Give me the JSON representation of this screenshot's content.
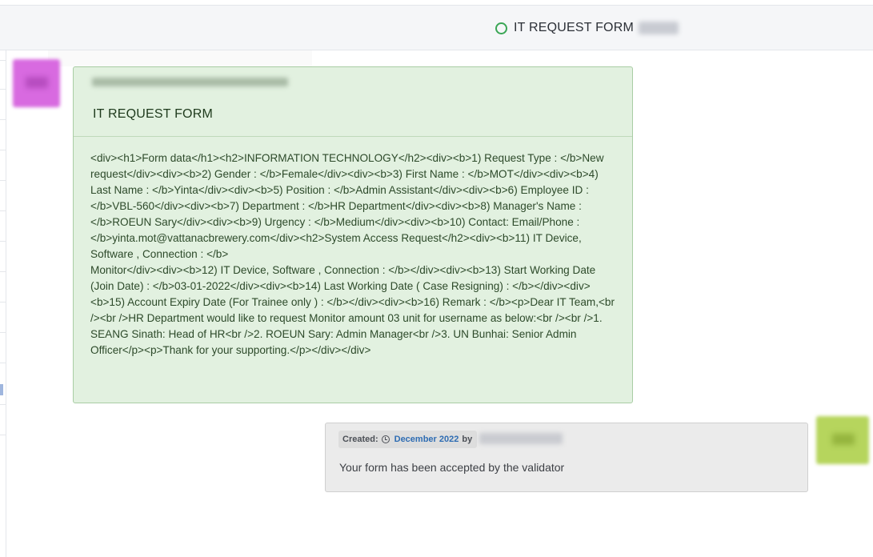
{
  "header": {
    "title": "IT REQUEST FORM",
    "status_icon": "circle-outline-icon",
    "status_color": "#3aa655"
  },
  "form_message": {
    "title": "IT REQUEST FORM",
    "body": "<div><h1>Form data</h1><h2>INFORMATION TECHNOLOGY</h2><div><b>1) Request Type : </b>New request</div><div><b>2) Gender : </b>Female</div><div><b>3) First Name : </b>MOT</div><div><b>4) Last Name : </b>Yinta</div><div><b>5) Position : </b>Admin Assistant</div><div><b>6) Employee ID : </b>VBL-560</div><div><b>7) Department : </b>HR Department</div><div><b>8) Manager's Name : </b>ROEUN Sary</div><div><b>9) Urgency : </b>Medium</div><div><b>10) Contact: Email/Phone : </b>yinta.mot@vattanacbrewery.com</div><h2>System Access Request</h2><div><b>11) IT Device, Software , Connection : </b>\nMonitor</div><div><b>12) IT Device, Software , Connection : </b></div><div><b>13) Start Working Date (Join Date) : </b>03-01-2022</div><div><b>14) Last Working Date ( Case Resigning) : </b></div><div><b>15) Account Expiry Date (For Trainee only ) : </b></div><div><b>16) Remark : </b><p>Dear IT Team,<br /><br />HR Department would like to request Monitor amount 03 unit for username as below:<br /><br />1. SEANG Sinath: Head of HR<br />2. ROEUN Sary: Admin Manager<br />3. UN Bunhai: Senior Admin Officer</p><p>Thank for your supporting.</p></div></div>",
    "background": "#e2f1e0"
  },
  "reply_message": {
    "created_label": "Created:",
    "date": "December 2022",
    "by_label": "by",
    "text": "Your form has been accepted by the validator"
  }
}
